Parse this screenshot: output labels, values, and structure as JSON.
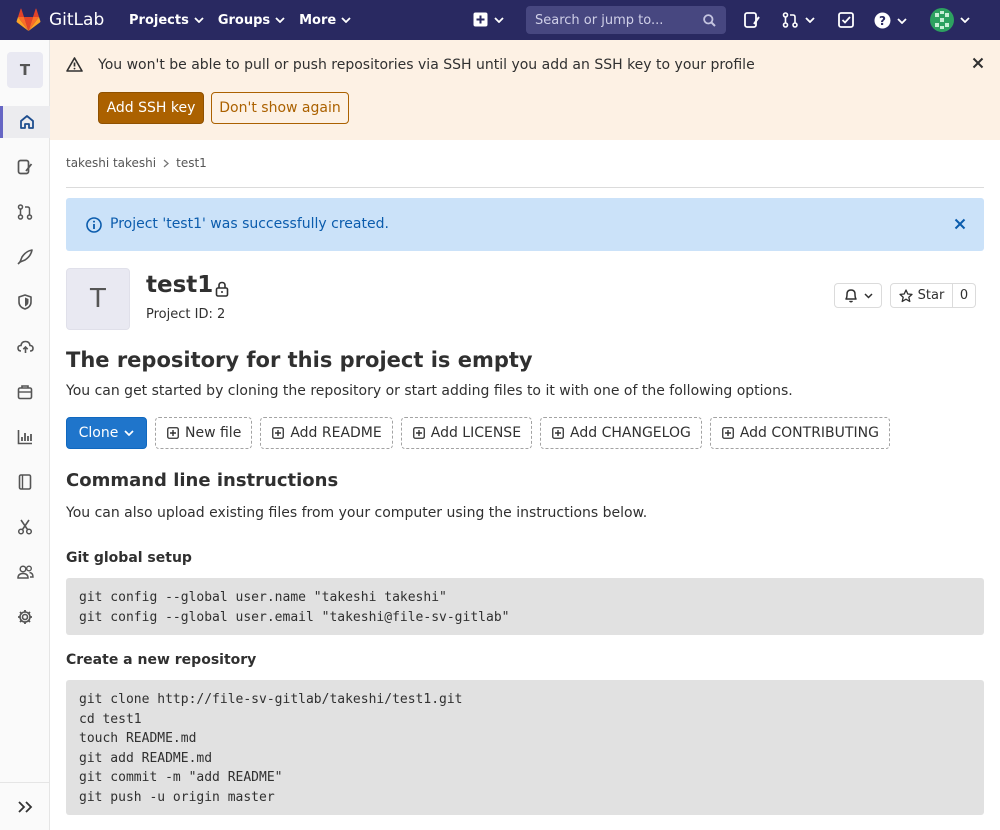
{
  "nav": {
    "brand": "GitLab",
    "menu": [
      "Projects",
      "Groups",
      "More"
    ],
    "search_placeholder": "Search or jump to..."
  },
  "sidebar": {
    "project_letter": "T",
    "items": [
      "project-overview",
      "issues",
      "merge-requests",
      "ci-cd",
      "security",
      "deployments",
      "packages",
      "analytics",
      "wiki",
      "snippets",
      "members",
      "settings"
    ]
  },
  "ssh_banner": {
    "message": "You won't be able to pull or push repositories via SSH until you add an SSH key to your profile",
    "add_key": "Add SSH key",
    "dont_show": "Don't show again"
  },
  "breadcrumb": [
    "takeshi takeshi",
    "test1"
  ],
  "flash": "Project 'test1' was successfully created.",
  "project": {
    "letter": "T",
    "name": "test1",
    "id_text": "Project ID: 2",
    "star_label": "Star",
    "star_count": "0"
  },
  "empty": {
    "title": "The repository for this project is empty",
    "description": "You can get started by cloning the repository or start adding files to it with one of the following options."
  },
  "actions": {
    "clone": "Clone",
    "buttons": [
      "New file",
      "Add README",
      "Add LICENSE",
      "Add CHANGELOG",
      "Add CONTRIBUTING"
    ]
  },
  "cli": {
    "title": "Command line instructions",
    "description": "You can also upload existing files from your computer using the instructions below.",
    "global_title": "Git global setup",
    "global_code": "git config --global user.name \"takeshi takeshi\"\ngit config --global user.email \"takeshi@file-sv-gitlab\"",
    "new_repo_title": "Create a new repository",
    "new_repo_code": "git clone http://file-sv-gitlab/takeshi/test1.git\ncd test1\ntouch README.md\ngit add README.md\ngit commit -m \"add README\"\ngit push -u origin master"
  },
  "colors": {
    "navbar": "#292961",
    "accent": "#1f75cb",
    "warning": "#ab6100",
    "info_bg": "#cbe2f9"
  }
}
